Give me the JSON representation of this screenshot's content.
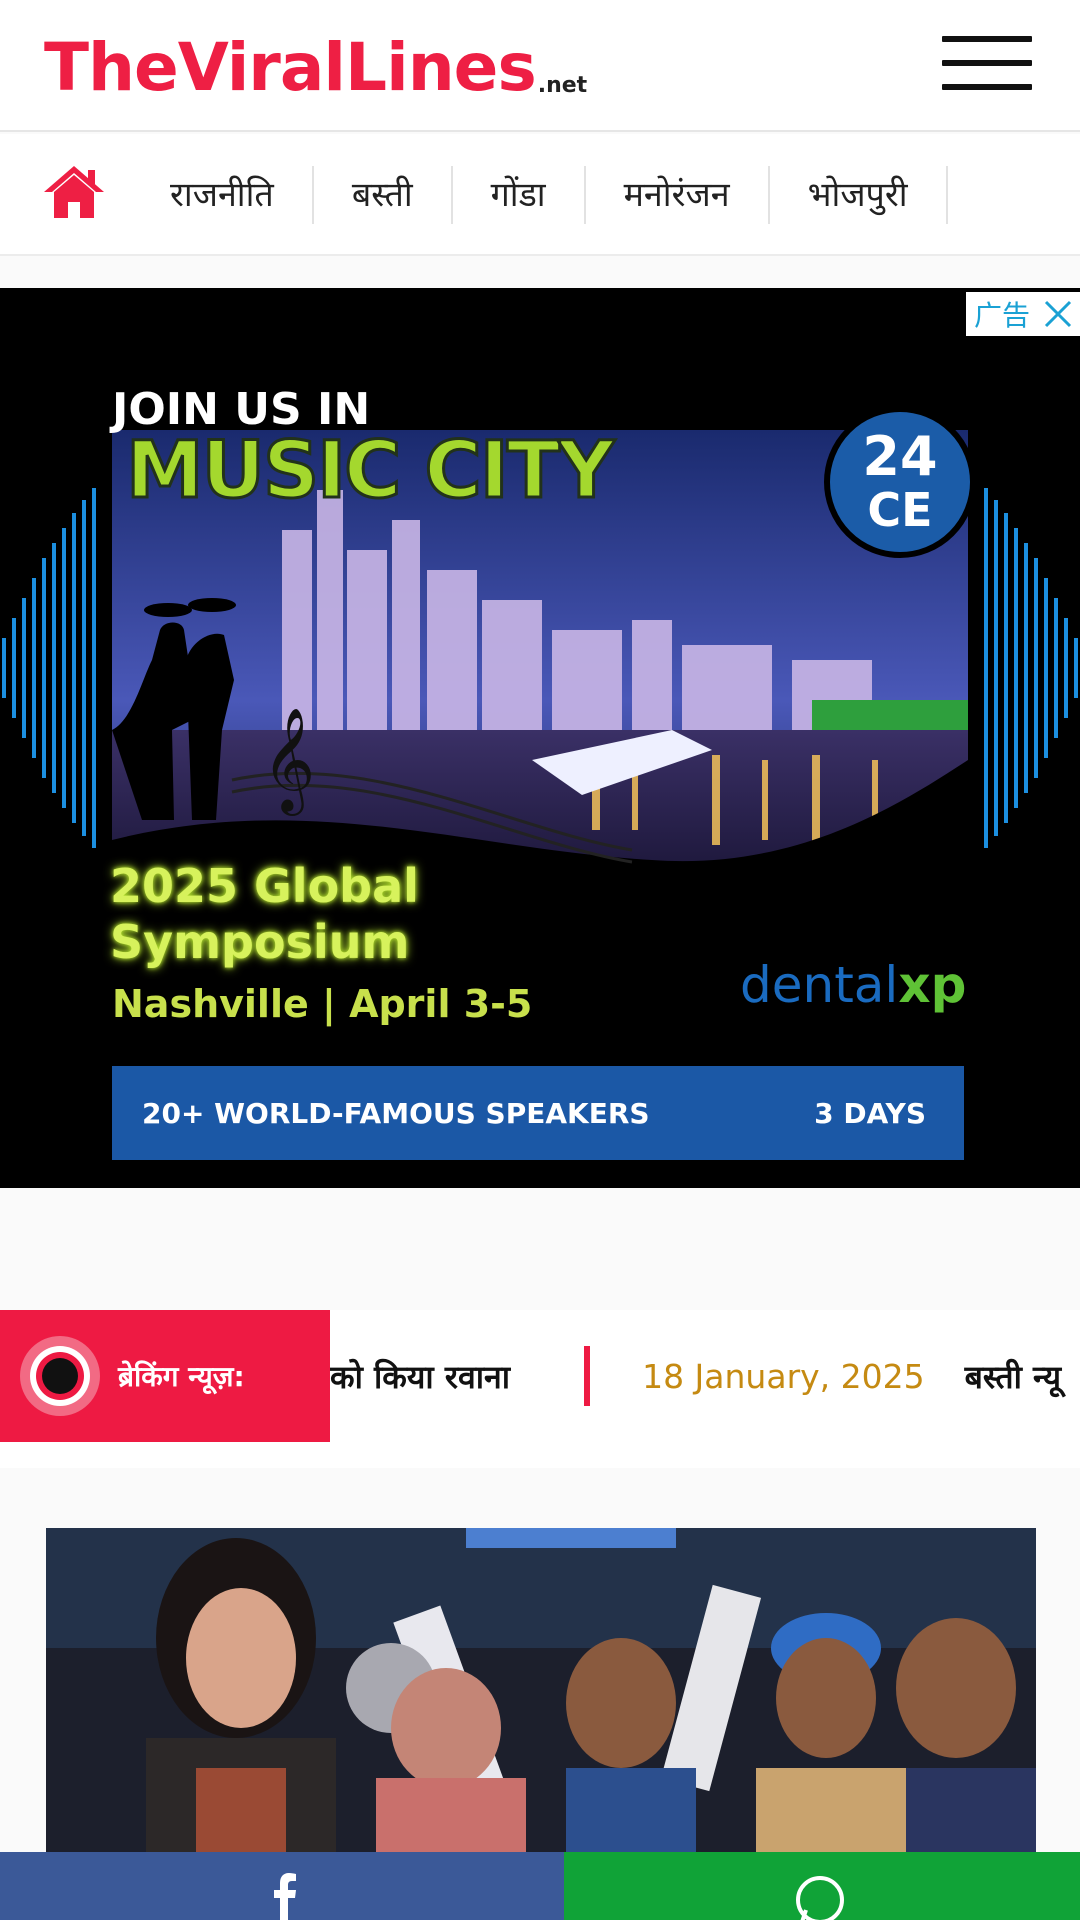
{
  "header": {
    "logo_text": "TheViralLines",
    "logo_suffix": ".net",
    "menu_icon": "hamburger-menu-icon"
  },
  "category_nav": {
    "home_icon": "home-icon",
    "items": [
      {
        "label": "राजनीति"
      },
      {
        "label": "बस्ती"
      },
      {
        "label": "गोंडा"
      },
      {
        "label": "मनोरंजन"
      },
      {
        "label": "भोजपुरी"
      }
    ]
  },
  "ad": {
    "flag_label": "广告",
    "close_icon": "close-icon",
    "join_text": "JOIN US IN",
    "headline": "MUSIC CITY",
    "badge_number": "24",
    "badge_sub": "CE",
    "event_title": "2025 Global Symposium",
    "location": "Nashville | April 3-5",
    "brand_part1": "dental",
    "brand_part2": "xp",
    "banner_left": "20+ WORLD-FAMOUS SPEAKERS",
    "banner_right": "3 DAYS"
  },
  "breaking_news": {
    "label": "ब्रेकिंग न्यूज़:",
    "icon": "live-dot-icon",
    "ticker_item_text": "को किया रवाना",
    "ticker_date": "18 January, 2025",
    "ticker_next_text": "बस्ती न्यू"
  },
  "share_bar": {
    "facebook_icon": "facebook-icon",
    "whatsapp_icon": "whatsapp-icon"
  },
  "colors": {
    "brand_red": "#ee1f44",
    "breaking_red": "#ee1a43",
    "date_gold": "#c58a12",
    "facebook_blue": "#3b5998",
    "whatsapp_green": "#10a337"
  }
}
